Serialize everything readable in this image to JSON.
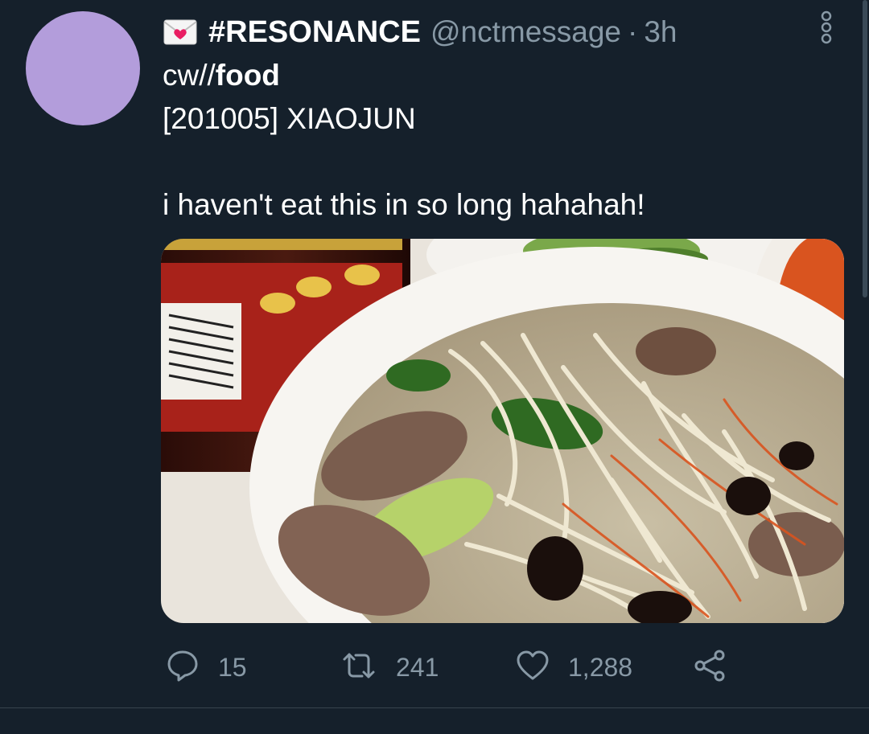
{
  "tweet": {
    "display_name": "#RESONANCE",
    "handle": "@nctmessage",
    "separator": "·",
    "time": "3h",
    "cw_prefix": "cw//",
    "cw_topic": "food",
    "date_line": "[201005] XIAOJUN",
    "message": "i haven't eat this in so long hahahah!",
    "media_icon": "photo-noodle-soup",
    "avatar_color": "#b39ddb"
  },
  "actions": {
    "reply_count": "15",
    "retweet_count": "241",
    "like_count": "1,288"
  },
  "icons": {
    "envelope": "love-letter-icon",
    "more": "more-vertical-icon",
    "reply": "reply-icon",
    "retweet": "retweet-icon",
    "like": "heart-icon",
    "share": "share-icon"
  },
  "colors": {
    "background": "#15202b",
    "secondary_text": "#8899a6",
    "divider": "#38444d"
  }
}
